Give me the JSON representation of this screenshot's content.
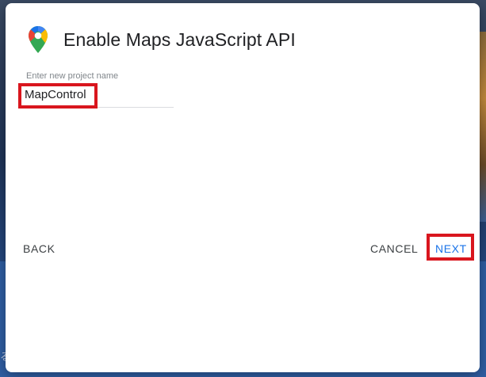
{
  "dialog": {
    "title": "Enable Maps JavaScript API",
    "icon": "google-maps-pin-icon"
  },
  "project_field": {
    "label": "Enter new project name",
    "value": "MapControl"
  },
  "actions": {
    "back_label": "BACK",
    "cancel_label": "CANCEL",
    "next_label": "NEXT"
  },
  "colors": {
    "next_accent": "#1a73e8",
    "highlight": "#d9161e",
    "backdrop": "#2f5ea3"
  },
  "edge_glyph": "る"
}
